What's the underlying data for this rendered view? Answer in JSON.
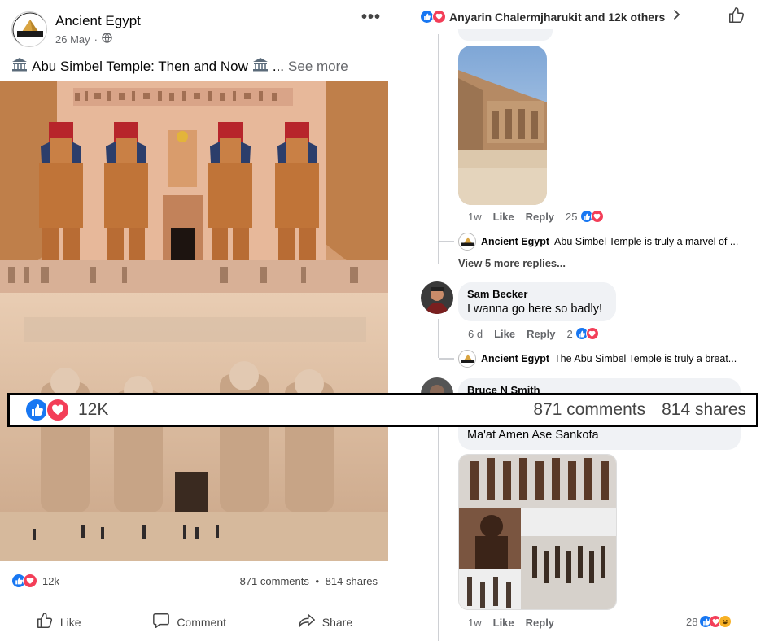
{
  "post": {
    "page_name": "Ancient Egypt",
    "logo_text": "ANCIENT EGYPT",
    "date": "26 May",
    "dot": "·",
    "caption": "Abu Simbel Temple: Then and Now",
    "caption_ellipsis": "...",
    "see_more": "See more",
    "reactions_count": "12k",
    "comments": "871 comments",
    "bullet": "•",
    "shares": "814 shares",
    "actions": {
      "like": "Like",
      "comment": "Comment",
      "share": "Share"
    }
  },
  "highlight": {
    "count": "12K",
    "comments": "871 comments",
    "shares": "814 shares"
  },
  "comments_panel": {
    "header": "Anyarin Chalermjharukit and 12k others",
    "comment1": {
      "time": "1w",
      "like": "Like",
      "reply": "Reply",
      "reactions": "25"
    },
    "reply1": {
      "name": "Ancient Egypt",
      "text": "Abu Simbel Temple is truly a marvel of ..."
    },
    "view_more": "View 5 more replies...",
    "comment2": {
      "name": "Sam Becker",
      "text": "I wanna go here so badly!",
      "time": "6 d",
      "like": "Like",
      "reply": "Reply",
      "reactions": "2"
    },
    "reply2": {
      "name": "Ancient Egypt",
      "text": "The Abu Simbel Temple is truly a breat..."
    },
    "comment3": {
      "name": "Bruce N Smith",
      "text": "Ma'at Amen Ase Sankofa",
      "time": "1w",
      "like": "Like",
      "reply": "Reply",
      "reactions": "28"
    }
  },
  "colors": {
    "like": "#1877f2",
    "love": "#f33e58",
    "haha": "#f7b125",
    "border": "#000000"
  }
}
